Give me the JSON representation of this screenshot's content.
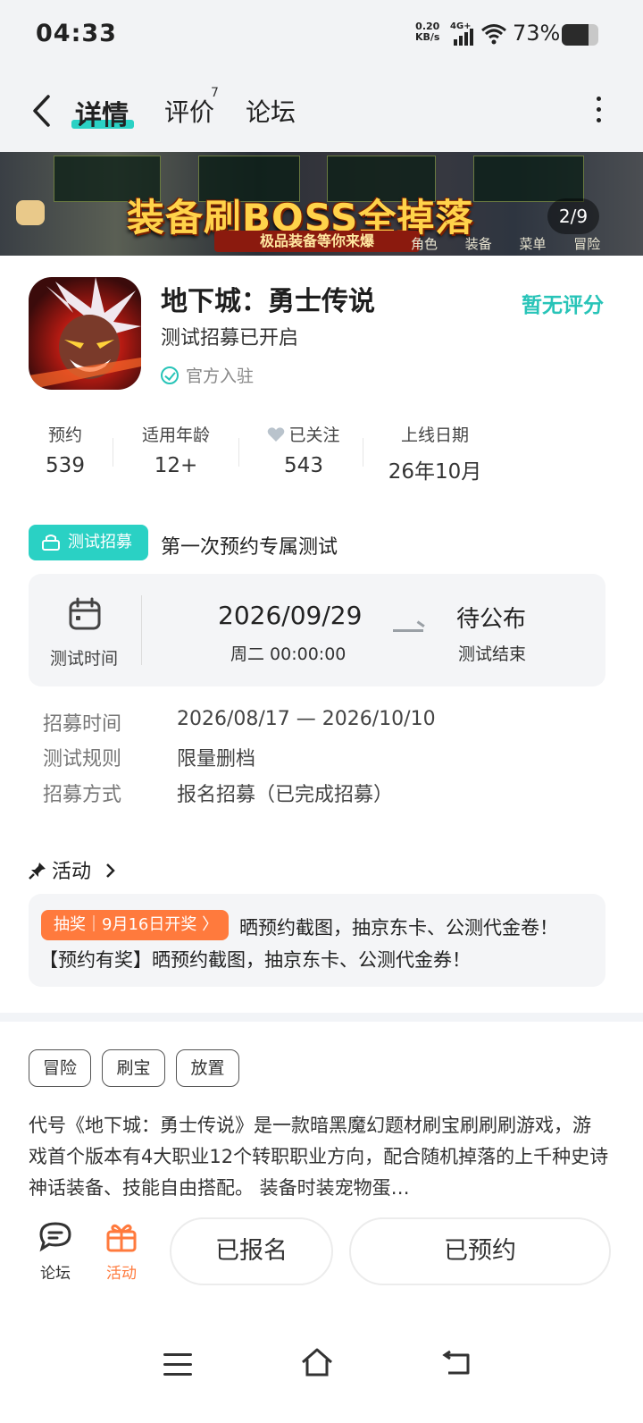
{
  "status": {
    "time": "04:33",
    "net_speed_top": "0.20",
    "net_speed_bottom": "KB/s",
    "signal": "4G+",
    "battery": "73%"
  },
  "nav": {
    "tabs": [
      "详情",
      "评价",
      "论坛"
    ],
    "review_badge": "7"
  },
  "banner": {
    "title": "装备刷BOSS全掉落",
    "subtitle": "极品装备等你来爆",
    "counter": "2/9",
    "tabs": "角色 装备 菜单 冒险"
  },
  "app": {
    "name": "地下城：勇士传说",
    "rating": "暂无评分",
    "subtitle": "测试招募已开启",
    "official": "官方入驻"
  },
  "stats": [
    {
      "label": "预约",
      "value": "539"
    },
    {
      "label": "适用年龄",
      "value": "12+"
    },
    {
      "label": "已关注",
      "value": "543"
    },
    {
      "label": "上线日期",
      "value": "26年10月"
    }
  ],
  "test": {
    "badge": "测试招募",
    "title": "第一次预约专属测试",
    "time_label": "测试时间",
    "start_date": "2026/09/29",
    "start_sub": "周二  00:00:00",
    "end_main": "待公布",
    "end_sub": "测试结束",
    "info": [
      {
        "key": "招募时间",
        "value": "2026/08/17 — 2026/10/10"
      },
      {
        "key": "测试规则",
        "value": "限量删档"
      },
      {
        "key": "招募方式",
        "value": "报名招募（已完成招募）"
      }
    ]
  },
  "activity": {
    "heading": "活动",
    "tag": "抽奖｜9月16日开奖 〉",
    "line1": "晒预约截图，抽京东卡、公测代金卷！",
    "line2": "【预约有奖】晒预约截图，抽京东卡、公测代金券！"
  },
  "tags": [
    "冒险",
    "刷宝",
    "放置"
  ],
  "description": "代号《地下城：勇士传说》是一款暗黑魔幻题材刷宝刷刷刷游戏，游戏首个版本有4大职业12个转职职业方向，配合随机掉落的上千种史诗神话装备、技能自由搭配。 装备时装宠物蛋…",
  "bottom": {
    "forum": "论坛",
    "activity": "活动",
    "registered": "已报名",
    "reserved": "已预约"
  },
  "colors": {
    "accent": "#2ad1c4",
    "orange": "#ff7a3d"
  }
}
